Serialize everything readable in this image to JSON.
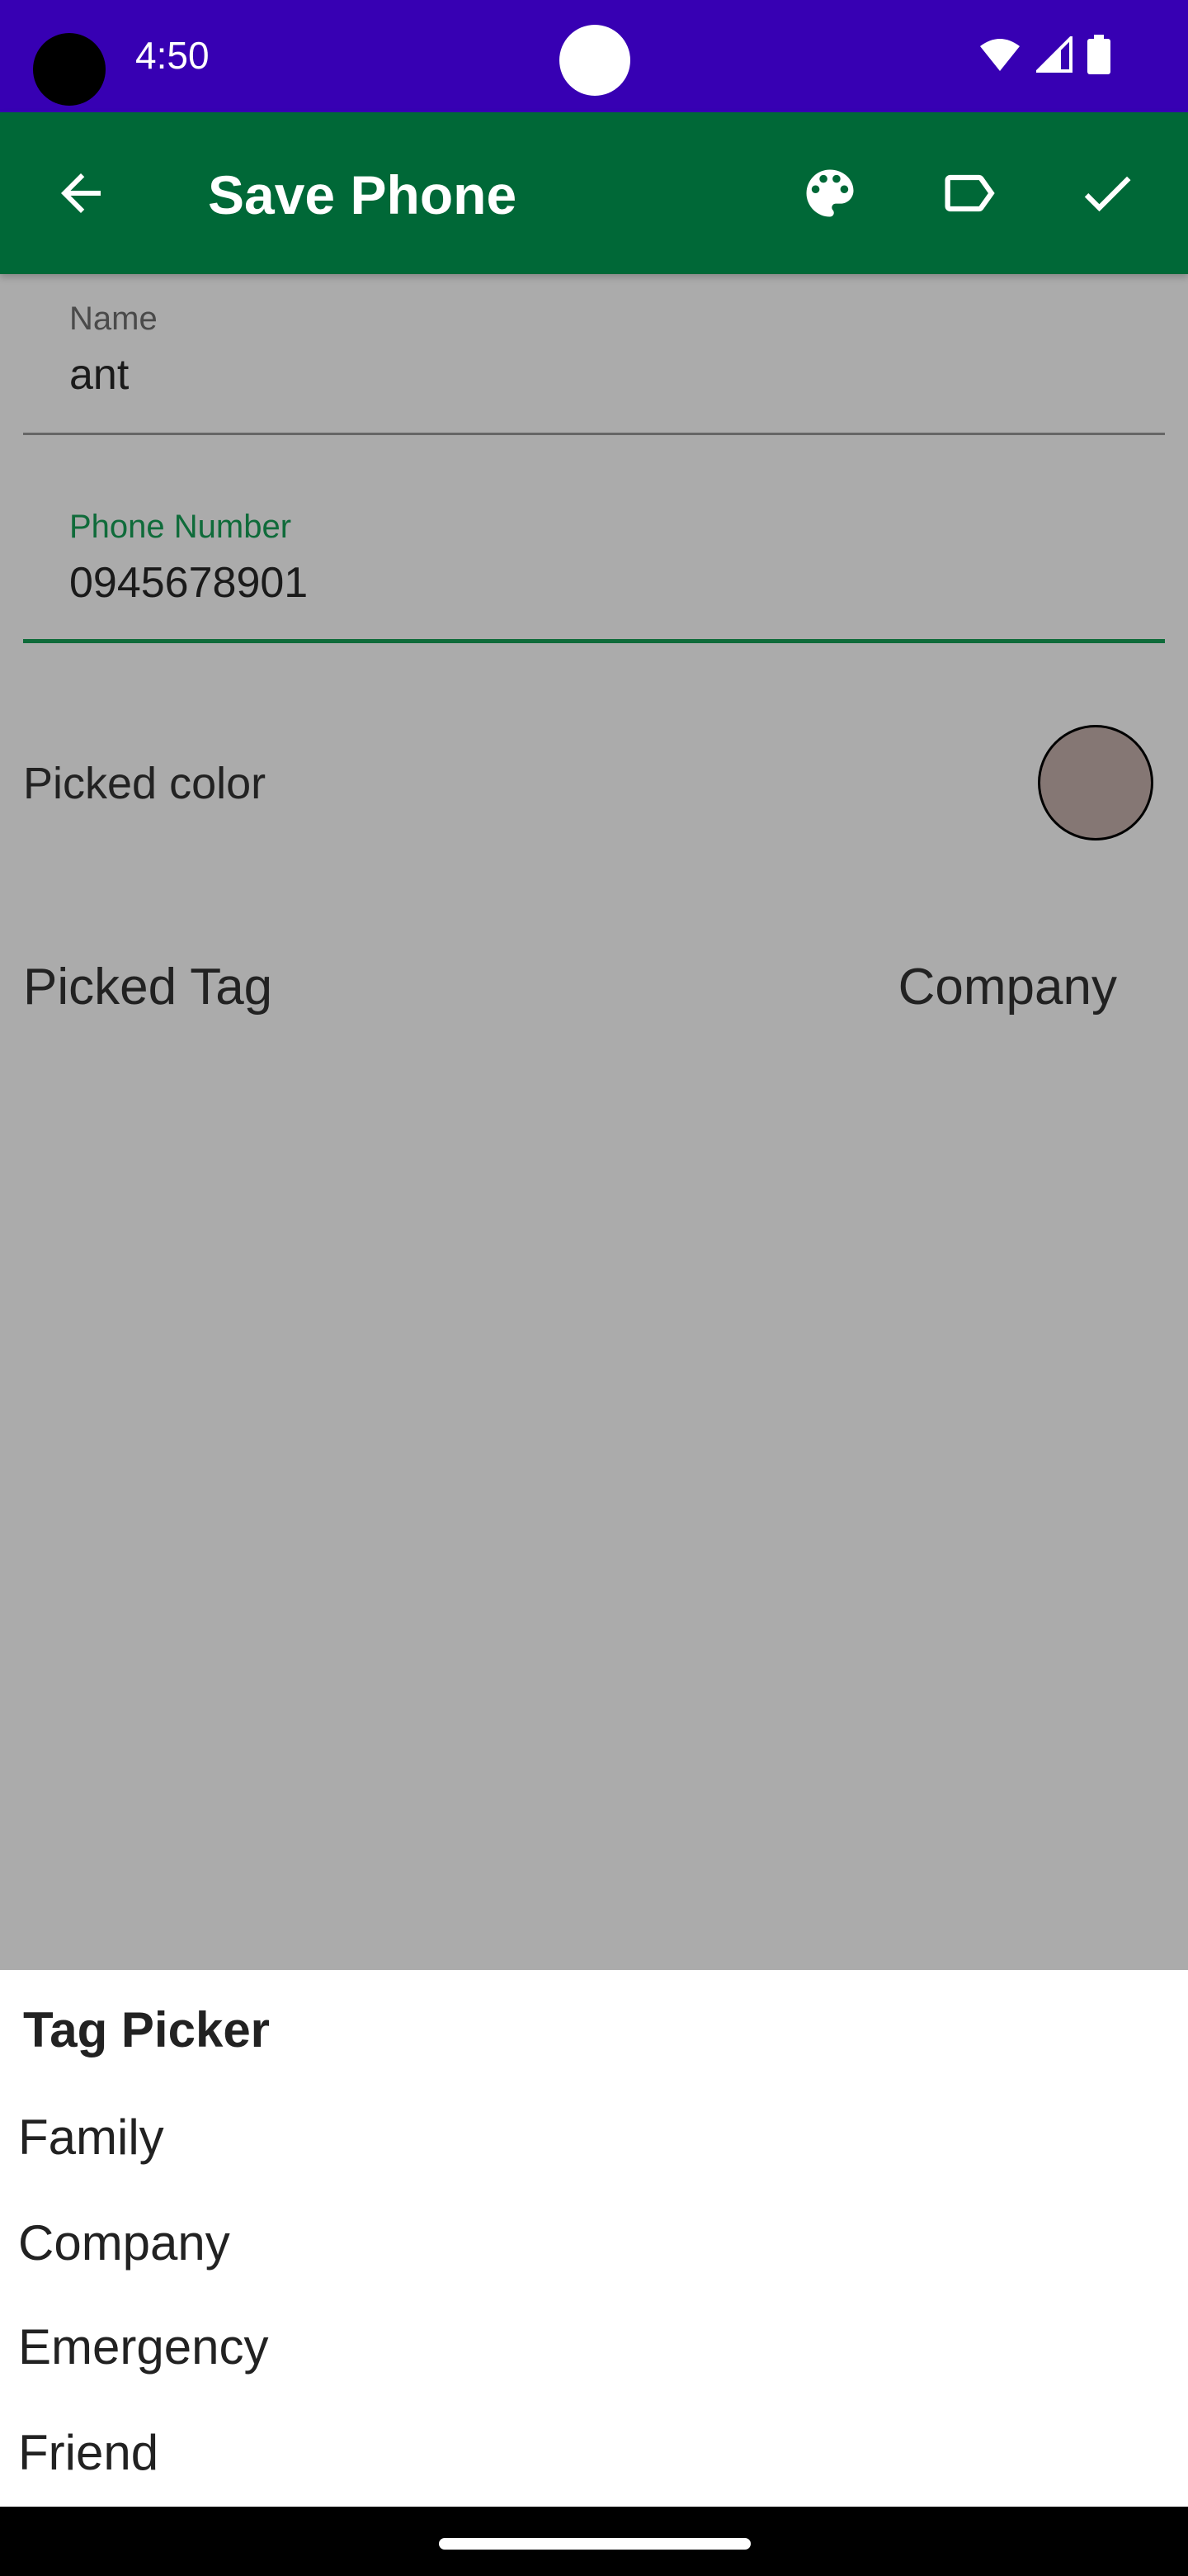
{
  "status_bar": {
    "time": "4:50"
  },
  "app_bar": {
    "title": "Save Phone",
    "icons": [
      "arrow-back-icon",
      "palette-icon",
      "label-icon",
      "check-icon"
    ]
  },
  "form": {
    "name": {
      "label": "Name",
      "value": "ant"
    },
    "phone": {
      "label": "Phone Number",
      "value": "0945678901"
    },
    "picked_color": {
      "label": "Picked color",
      "color": "#857774"
    },
    "picked_tag": {
      "label": "Picked Tag",
      "value": "Company"
    }
  },
  "tag_picker": {
    "title": "Tag Picker",
    "options": [
      "Family",
      "Company",
      "Emergency",
      "Friend"
    ]
  },
  "colors": {
    "status_bar": "#3700b3",
    "app_bar": "#006837",
    "focus_accent": "#0f6b3a",
    "scrim": "#ababab"
  }
}
